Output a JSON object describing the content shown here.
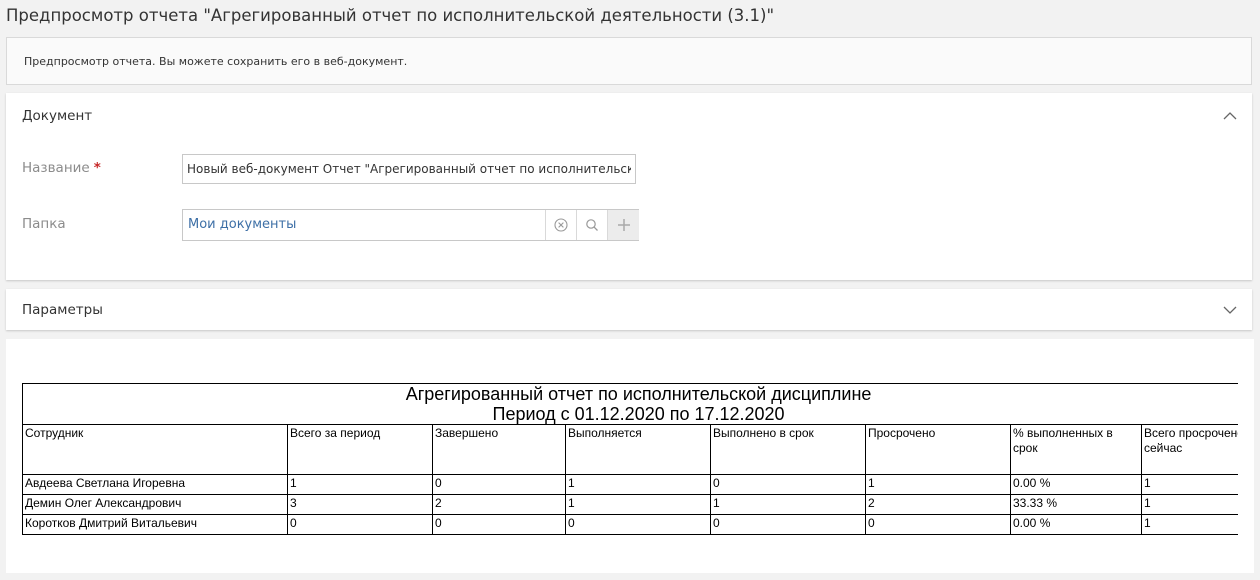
{
  "page": {
    "title": "Предпросмотр отчета \"Агрегированный отчет по исполнительской деятельности (3.1)\""
  },
  "info": {
    "text": "Предпросмотр отчета. Вы можете сохранить его в веб-документ."
  },
  "document_section": {
    "title": "Документ",
    "name_label": "Название",
    "required_mark": "*",
    "name_value": "Новый веб-документ Отчет \"Агрегированный отчет по исполнительской дисциплине\"",
    "folder_label": "Папка",
    "folder_value": "Мои документы",
    "icons": {
      "collapse": "chevron-up-icon",
      "clear": "clear-circle-icon",
      "search": "search-icon",
      "add": "plus-icon"
    }
  },
  "parameters_section": {
    "title": "Параметры",
    "icon": "chevron-down-icon"
  },
  "report": {
    "title_line1": "Агрегированный отчет по исполнительской дисциплине",
    "title_line2": "Период с 01.12.2020 по 17.12.2020",
    "columns": [
      "Сотрудник",
      "Всего за период",
      "Завершено",
      "Выполняется",
      "Выполнено в срок",
      "Просрочено",
      "% выполненных в срок",
      "Всего просрочено сейчас"
    ],
    "rows": [
      [
        "Авдеева Светлана Игоревна",
        "1",
        "0",
        "1",
        "0",
        "1",
        "0.00 %",
        "1"
      ],
      [
        "Демин Олег Александрович",
        "3",
        "2",
        "1",
        "1",
        "2",
        "33.33 %",
        "1"
      ],
      [
        "Коротков Дмитрий Витальевич",
        "0",
        "0",
        "0",
        "0",
        "0",
        "0.00 %",
        "1"
      ]
    ]
  },
  "colors": {
    "accent_link": "#3d6fa6",
    "required": "#c62828",
    "background": "#f2f2f2"
  }
}
